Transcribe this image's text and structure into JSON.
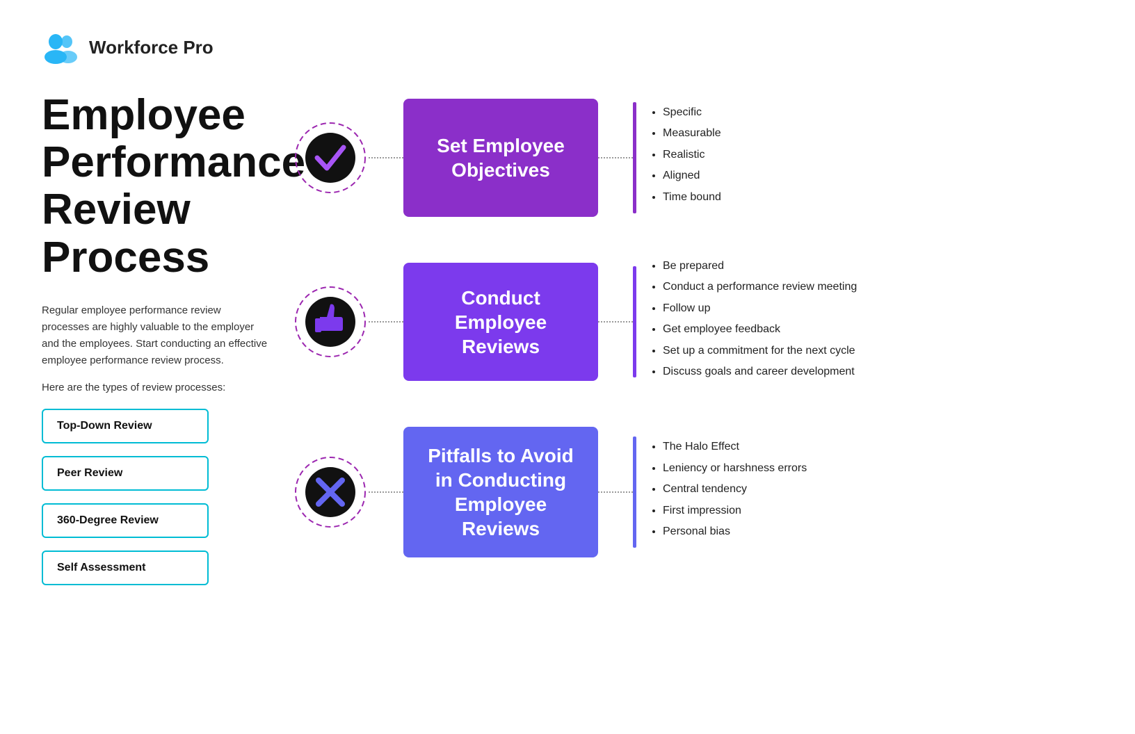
{
  "brand": {
    "name": "Workforce Pro"
  },
  "page_title": "Employee Performance Review Process",
  "description_1": "Regular employee performance review processes are highly valuable to the employer and the employees. Start conducting an effective employee performance review process.",
  "description_2": "Here are the types of review processes:",
  "review_buttons": [
    "Top-Down Review",
    "Peer Review",
    "360-Degree Review",
    "Self Assessment"
  ],
  "flow_rows": [
    {
      "box_label": "Set Employee Objectives",
      "box_color_class": "box-purple",
      "accent_class": "",
      "icon_type": "checkmark",
      "bullets": [
        "Specific",
        "Measurable",
        "Realistic",
        "Aligned",
        "Time bound"
      ]
    },
    {
      "box_label": "Conduct Employee Reviews",
      "box_color_class": "box-violet",
      "accent_class": "accent-bar-violet",
      "icon_type": "thumbsup",
      "bullets": [
        "Be prepared",
        "Conduct a performance review meeting",
        "Follow up",
        "Get employee feedback",
        "Set up a commitment for the next cycle",
        "Discuss goals and career development"
      ]
    },
    {
      "box_label": "Pitfalls to Avoid in Conducting Employee Reviews",
      "box_color_class": "box-indigo",
      "accent_class": "accent-bar-indigo",
      "icon_type": "cross",
      "bullets": [
        "The Halo Effect",
        "Leniency or harshness errors",
        "Central tendency",
        "First impression",
        "Personal bias"
      ]
    }
  ]
}
